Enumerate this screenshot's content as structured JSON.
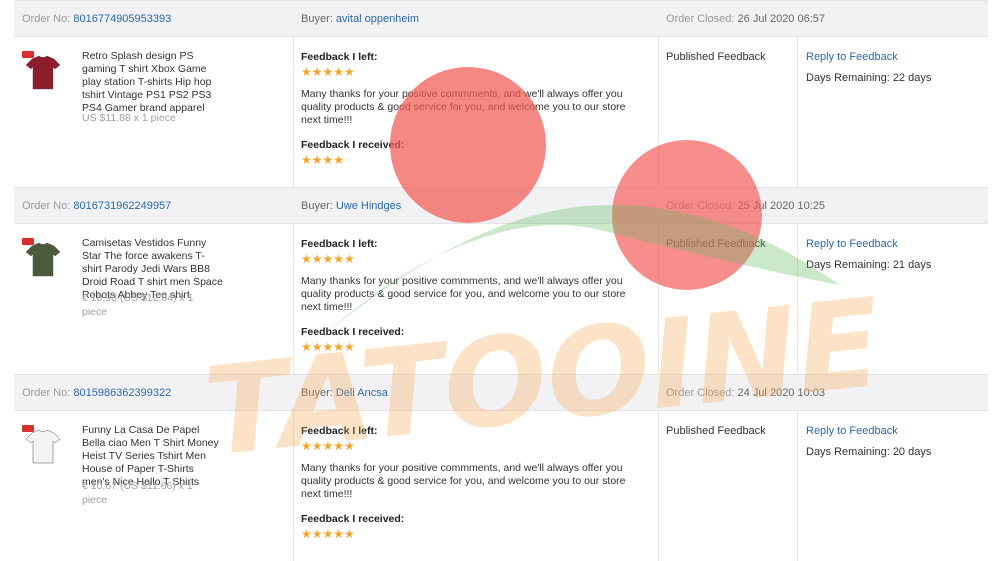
{
  "orders": [
    {
      "order_label": "Order No:",
      "order_no": "8016774905953393",
      "buyer_label": "Buyer:",
      "buyer": "avital oppenheim",
      "closed_label": "Order Closed:",
      "closed": "26 Jul 2020 06:57",
      "product_title": "Retro Splash design PS gaming T shirt Xbox Game play station T-shirts Hip hop tshirt Vintage PS1 PS2 PS3 PS4 Gamer brand apparel",
      "price": "US $11.88 x 1 piece",
      "feedback_left_label": "Feedback I left:",
      "stars_left": "★★★★★",
      "stars_left_value": 5,
      "feedback_text": "Many thanks for your positive commments, and we'll always offer you quality products & good service for you, and welcome you to our store next time!!!",
      "feedback_received_label": "Feedback I received:",
      "stars_received": "★★★★",
      "stars_received_value": 4,
      "status": "Published Feedback",
      "reply_link": "Reply to Feedback",
      "days_remaining": "Days Remaining: 22 days",
      "shirt_color": "#8c1d2a"
    },
    {
      "order_label": "Order No:",
      "order_no": "8016731962249957",
      "buyer_label": "Buyer:",
      "buyer": "Uwe Hindges",
      "closed_label": "Order Closed:",
      "closed": "25 Jul 2020 10:25",
      "product_title": "Camisetas Vestidos Funny Star The force awakens T-shirt Parody Jedi Wars BB8 Droid Road T shirt men Space Robots Abbey Tee shirt",
      "price": "€ 10,93 (US $12.04) x 1 piece",
      "feedback_left_label": "Feedback I left:",
      "stars_left": "★★★★★",
      "stars_left_value": 5,
      "feedback_text": "Many thanks for your positive commments, and we'll always offer you quality products & good service for you, and welcome you to our store next time!!!",
      "feedback_received_label": "Feedback I received:",
      "stars_received": "★★★★★",
      "stars_received_value": 5,
      "status": "Published Feedback",
      "reply_link": "Reply to Feedback",
      "days_remaining": "Days Remaining: 21 days",
      "shirt_color": "#4a5a3a"
    },
    {
      "order_label": "Order No:",
      "order_no": "8015986362399322",
      "buyer_label": "Buyer:",
      "buyer": "Deli Ancsa",
      "closed_label": "Order Closed:",
      "closed": "24 Jul 2020 10:03",
      "product_title": "Funny La Casa De Papel Bella ciao Men T Shirt Money Heist TV Series Tshirt Men House of Paper T-Shirts men's Nice Hello T Shirts",
      "price": "€ 10,67 (US $11.66) x 1 piece",
      "feedback_left_label": "Feedback I left:",
      "stars_left": "★★★★★",
      "stars_left_value": 5,
      "feedback_text": "Many thanks for your positive commments, and we'll always offer you quality products & good service for you, and welcome you to our store next time!!!",
      "feedback_received_label": "Feedback I received:",
      "stars_received": "★★★★★",
      "stars_received_value": 5,
      "status": "Published Feedback",
      "reply_link": "Reply to Feedback",
      "days_remaining": "Days Remaining: 20 days",
      "shirt_color": "#f4f4f4"
    }
  ],
  "watermark": {
    "text": "TATOOINE"
  },
  "colors": {
    "link": "#2a69b0",
    "star": "#f5a623",
    "header_bg": "#f2f2f4"
  }
}
